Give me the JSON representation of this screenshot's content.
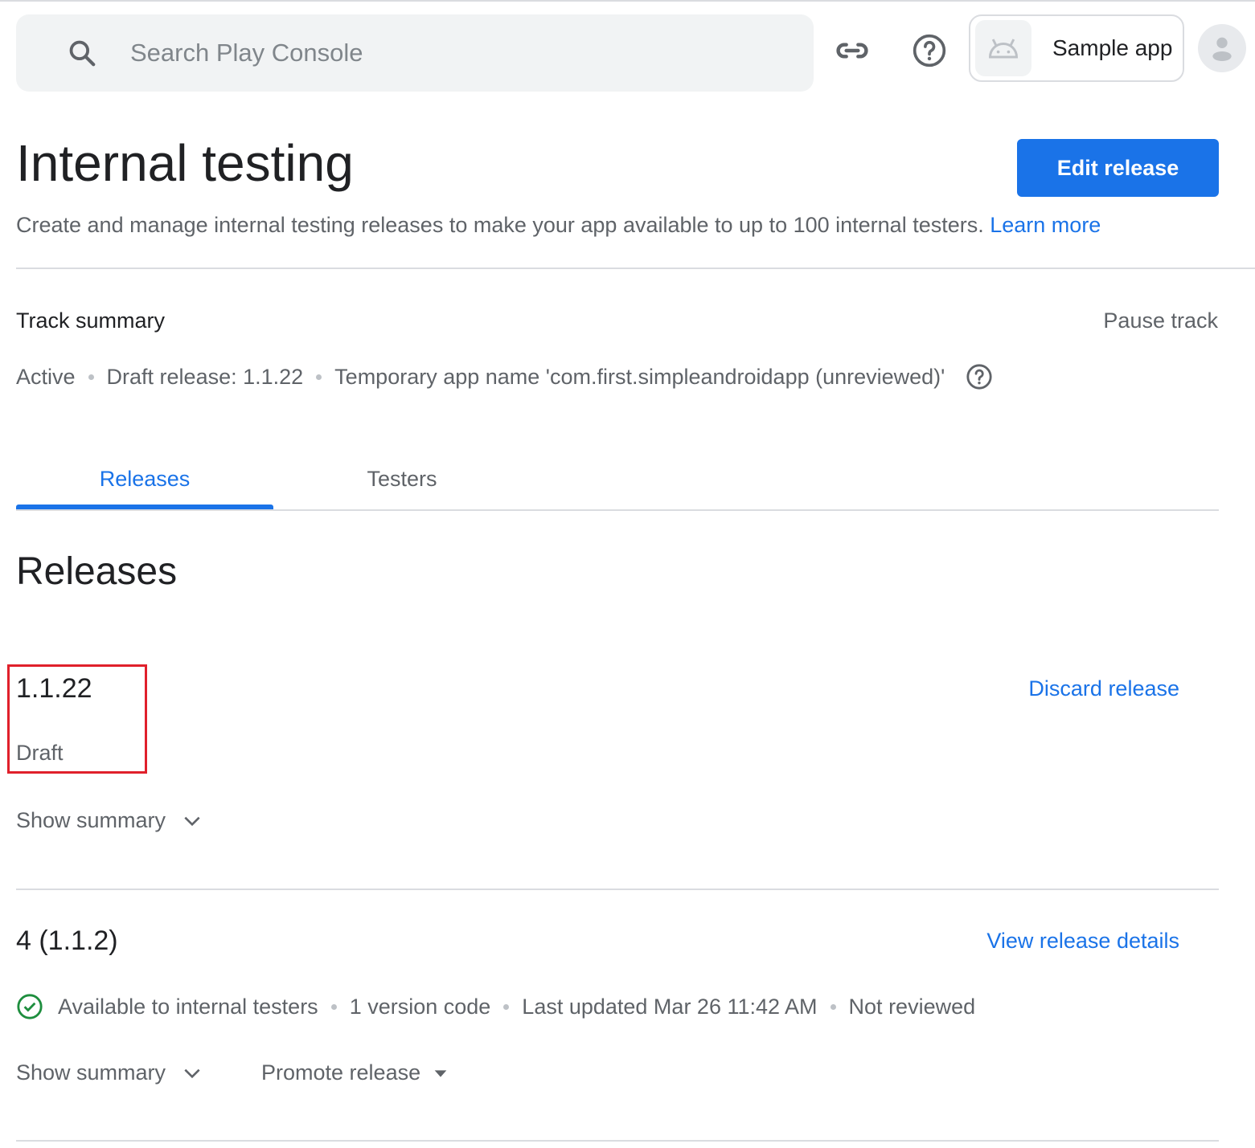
{
  "header": {
    "search_placeholder": "Search Play Console",
    "app_name": "Sample app"
  },
  "page": {
    "title": "Internal testing",
    "primary_action": "Edit release",
    "description": "Create and manage internal testing releases to make your app available to up to 100 internal testers.",
    "learn_more": "Learn more"
  },
  "track_summary": {
    "title": "Track summary",
    "pause_label": "Pause track",
    "items": [
      "Active",
      "Draft release: 1.1.22",
      "Temporary app name 'com.first.simpleandroidapp (unreviewed)'"
    ]
  },
  "tabs": [
    {
      "label": "Releases",
      "active": true
    },
    {
      "label": "Testers",
      "active": false
    }
  ],
  "releases": {
    "heading": "Releases",
    "items": [
      {
        "version": "1.1.22",
        "status": "Draft",
        "action": "Discard release",
        "show_summary": "Show summary"
      },
      {
        "version": "4 (1.1.2)",
        "action": "View release details",
        "meta": [
          "Available to internal testers",
          "1 version code",
          "Last updated Mar 26 11:42 AM",
          "Not reviewed"
        ],
        "show_summary": "Show summary",
        "promote": "Promote release"
      }
    ]
  },
  "colors": {
    "accent": "#1a73e8",
    "success": "#1e8e3e",
    "highlight": "#e0202b"
  }
}
